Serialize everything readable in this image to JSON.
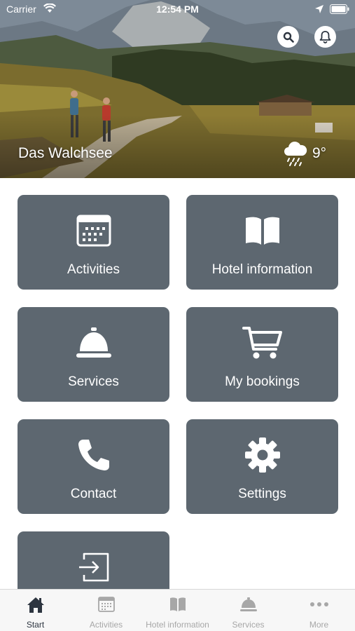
{
  "status_bar": {
    "carrier": "Carrier",
    "time": "12:54 PM"
  },
  "hero": {
    "location": "Das Walchsee",
    "temperature": "9°",
    "weather_icon": "rain-cloud-icon"
  },
  "tiles": [
    {
      "label": "Activities",
      "icon": "calendar-icon"
    },
    {
      "label": "Hotel information",
      "icon": "book-icon"
    },
    {
      "label": "Services",
      "icon": "service-bell-icon"
    },
    {
      "label": "My bookings",
      "icon": "cart-icon"
    },
    {
      "label": "Contact",
      "icon": "phone-icon"
    },
    {
      "label": "Settings",
      "icon": "gear-icon"
    },
    {
      "label": "",
      "icon": "sign-in-icon"
    }
  ],
  "tabbar": {
    "active": "Start",
    "items": [
      {
        "label": "Start",
        "icon": "home-icon"
      },
      {
        "label": "Activities",
        "icon": "calendar-icon"
      },
      {
        "label": "Hotel information",
        "icon": "book-icon"
      },
      {
        "label": "Services",
        "icon": "service-bell-icon"
      },
      {
        "label": "More",
        "icon": "more-icon"
      }
    ]
  },
  "colors": {
    "tile_bg": "#5d6770",
    "tab_active": "#2d3540",
    "tab_inactive": "#a7a7a7"
  }
}
